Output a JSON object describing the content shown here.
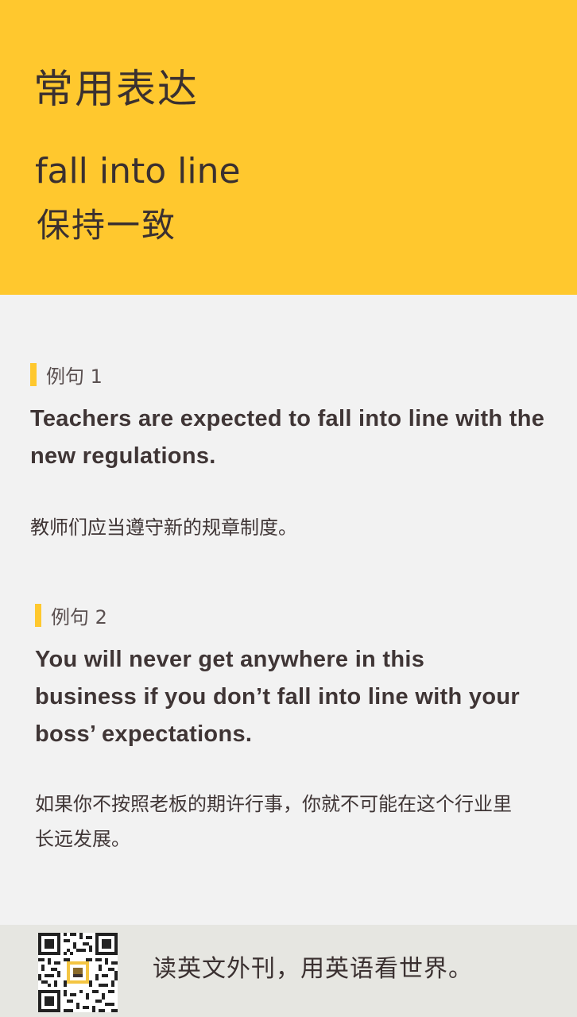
{
  "header": {
    "title": "常用表达",
    "phrase": "fall into line",
    "meaning": "保持一致"
  },
  "examples": [
    {
      "label": "例句 1",
      "english": "Teachers are expected to fall into line with the new regulations.",
      "chinese": "教师们应当遵守新的规章制度。"
    },
    {
      "label": "例句 2",
      "english": "You will never get anywhere in this business if you don’t fall into line with your boss’ expectations.",
      "chinese": "如果你不按照老板的期许行事，你就不可能在这个行业里长远发展。"
    }
  ],
  "footer": {
    "qr_icon": "qr-code-icon",
    "slogan": "读英文外刊，用英语看世界。"
  },
  "colors": {
    "accent": "#ffc82e",
    "background": "#f2f2f2",
    "footer_background": "#e6e6e1",
    "text": "#3f3535"
  }
}
